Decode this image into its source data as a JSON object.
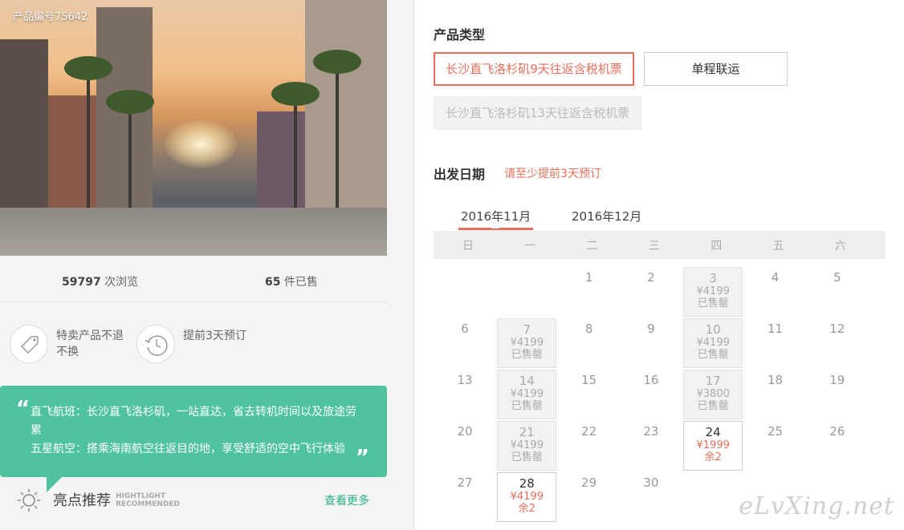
{
  "product": {
    "code": "产品编号75642",
    "views_num": "59797",
    "views_label": "次浏览",
    "sold_num": "65",
    "sold_label": "件已售"
  },
  "features": [
    {
      "icon": "tag-icon",
      "text": "特卖产品不退不换"
    },
    {
      "icon": "clock-icon",
      "text": "提前3天预订"
    }
  ],
  "highlights_bubble": {
    "line1": "直飞航班：长沙直飞洛杉矶，一站直达，省去转机时间以及旅途劳累",
    "line2": "五星航空：搭乘海南航空往返目的地，享受舒适的空中飞行体验"
  },
  "recommend": {
    "title": "亮点推荐",
    "en_line1": "HIGHTLIGHT",
    "en_line2": "RECOMMENDED",
    "more": "查看更多"
  },
  "product_type": {
    "title": "产品类型",
    "options": [
      {
        "label": "长沙直飞洛杉矶9天往返含税机票",
        "state": "selected"
      },
      {
        "label": "单程联运",
        "state": "normal"
      },
      {
        "label": "长沙直飞洛杉矶13天往返含税机票",
        "state": "disabled"
      }
    ]
  },
  "departure": {
    "title": "出发日期",
    "notice": "请至少提前3天预订"
  },
  "months": [
    {
      "label": "2016年11月",
      "active": true
    },
    {
      "label": "2016年12月",
      "active": false
    }
  ],
  "weekdays": [
    "日",
    "一",
    "二",
    "三",
    "四",
    "五",
    "六"
  ],
  "calendar": {
    "first_weekday": 2,
    "days_in_month": 30,
    "special": {
      "3": {
        "state": "sold",
        "price": "¥4199",
        "status": "已售罄"
      },
      "7": {
        "state": "sold",
        "price": "¥4199",
        "status": "已售罄"
      },
      "10": {
        "state": "sold",
        "price": "¥4199",
        "status": "已售罄"
      },
      "14": {
        "state": "sold",
        "price": "¥4199",
        "status": "已售罄"
      },
      "17": {
        "state": "sold",
        "price": "¥3800",
        "status": "已售罄"
      },
      "21": {
        "state": "sold",
        "price": "¥4199",
        "status": "已售罄"
      },
      "24": {
        "state": "avail",
        "price": "¥1999",
        "status": "余2"
      },
      "28": {
        "state": "avail",
        "price": "¥4199",
        "status": "余2"
      }
    }
  },
  "watermark": "eLvXing.net",
  "colors": {
    "accent": "#e8705a",
    "green": "#4fc39f"
  }
}
